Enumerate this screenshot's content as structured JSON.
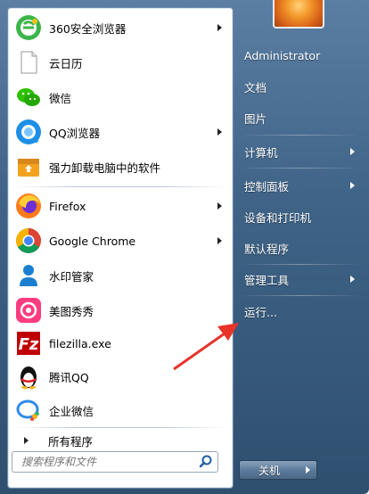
{
  "programs": [
    {
      "label": "360安全浏览器",
      "icon": "360-browser-icon",
      "has_submenu": true
    },
    {
      "label": "云日历",
      "icon": "blank-document-icon",
      "has_submenu": false
    },
    {
      "label": "微信",
      "icon": "wechat-icon",
      "has_submenu": false
    },
    {
      "label": "QQ浏览器",
      "icon": "qq-browser-icon",
      "has_submenu": true
    },
    {
      "label": "强力卸载电脑中的软件",
      "icon": "uninstall-box-icon",
      "has_submenu": false
    },
    {
      "label": "Firefox",
      "icon": "firefox-icon",
      "has_submenu": true
    },
    {
      "label": "Google Chrome",
      "icon": "chrome-icon",
      "has_submenu": true
    },
    {
      "label": "水印管家",
      "icon": "watermark-manager-icon",
      "has_submenu": false
    },
    {
      "label": "美图秀秀",
      "icon": "meitu-icon",
      "has_submenu": false
    },
    {
      "label": "filezilla.exe",
      "icon": "filezilla-icon",
      "has_submenu": false
    },
    {
      "label": "腾讯QQ",
      "icon": "qq-penguin-icon",
      "has_submenu": false
    },
    {
      "label": "企业微信",
      "icon": "wecom-icon",
      "has_submenu": false
    }
  ],
  "all_programs_label": "所有程序",
  "search": {
    "placeholder": "搜索程序和文件"
  },
  "right_menu": [
    {
      "label": "Administrator",
      "has_submenu": false
    },
    {
      "label": "文档",
      "has_submenu": false
    },
    {
      "label": "图片",
      "has_submenu": false
    },
    {
      "label": "计算机",
      "has_submenu": true
    },
    {
      "label": "控制面板",
      "has_submenu": true
    },
    {
      "label": "设备和打印机",
      "has_submenu": false
    },
    {
      "label": "默认程序",
      "has_submenu": false
    },
    {
      "label": "管理工具",
      "has_submenu": true
    },
    {
      "label": "运行...",
      "has_submenu": false
    }
  ],
  "shutdown_label": "关机",
  "colors": {
    "menu_bg": "#3f6487",
    "annotation_arrow": "#e8332a"
  }
}
